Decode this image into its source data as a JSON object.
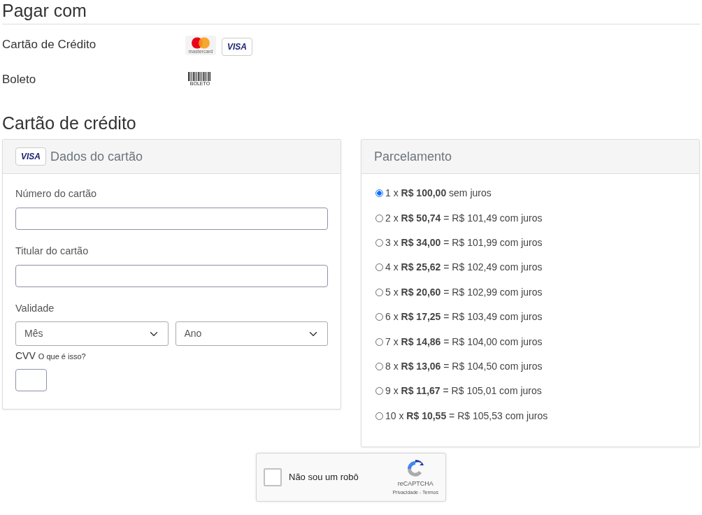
{
  "title": "Pagar com",
  "methods": [
    {
      "label": "Cartão de Crédito",
      "logos": [
        {
          "kind": "mastercard",
          "text": "mastercard"
        },
        {
          "kind": "visa",
          "text": "VISA"
        }
      ]
    },
    {
      "label": "Boleto",
      "logos": [
        {
          "kind": "boleto",
          "text": "BOLETO"
        }
      ]
    }
  ],
  "section_title": "Cartão de crédito",
  "card_panel": {
    "logo": "VISA",
    "title": "Dados do cartão",
    "number_label": "Número do cartão",
    "holder_label": "Titular do cartão",
    "validity_label": "Validade",
    "month_value": "Mês",
    "year_value": "Ano",
    "cvv_label": "CVV",
    "cvv_help": "O que é isso?"
  },
  "installments": {
    "title": "Parcelamento",
    "options": [
      {
        "label": "1 x **R$ 100,00** sem juros",
        "selected": true
      },
      {
        "label": "2 x **R$ 50,74** = R$ 101,49 com juros",
        "selected": false
      },
      {
        "label": "3 x **R$ 34,00** = R$ 101,99 com juros",
        "selected": false
      },
      {
        "label": "4 x **R$ 25,62** = R$ 102,49 com juros",
        "selected": false
      },
      {
        "label": "5 x **R$ 20,60** = R$ 102,99 com juros",
        "selected": false
      },
      {
        "label": "6 x **R$ 17,25** = R$ 103,49 com juros",
        "selected": false
      },
      {
        "label": "7 x **R$ 14,86** = R$ 104,00 com juros",
        "selected": false
      },
      {
        "label": "8 x **R$ 13,06** = R$ 104,50 com juros",
        "selected": false
      },
      {
        "label": "9 x **R$ 11,67** = R$ 105,01 com juros",
        "selected": false
      },
      {
        "label": "10 x **R$ 10,55** = R$ 105,53 com juros",
        "selected": false
      }
    ]
  },
  "captcha": {
    "label": "Não sou um robô",
    "checked": false,
    "brand": "reCAPTCHA",
    "links": "Privacidade - Termos"
  }
}
